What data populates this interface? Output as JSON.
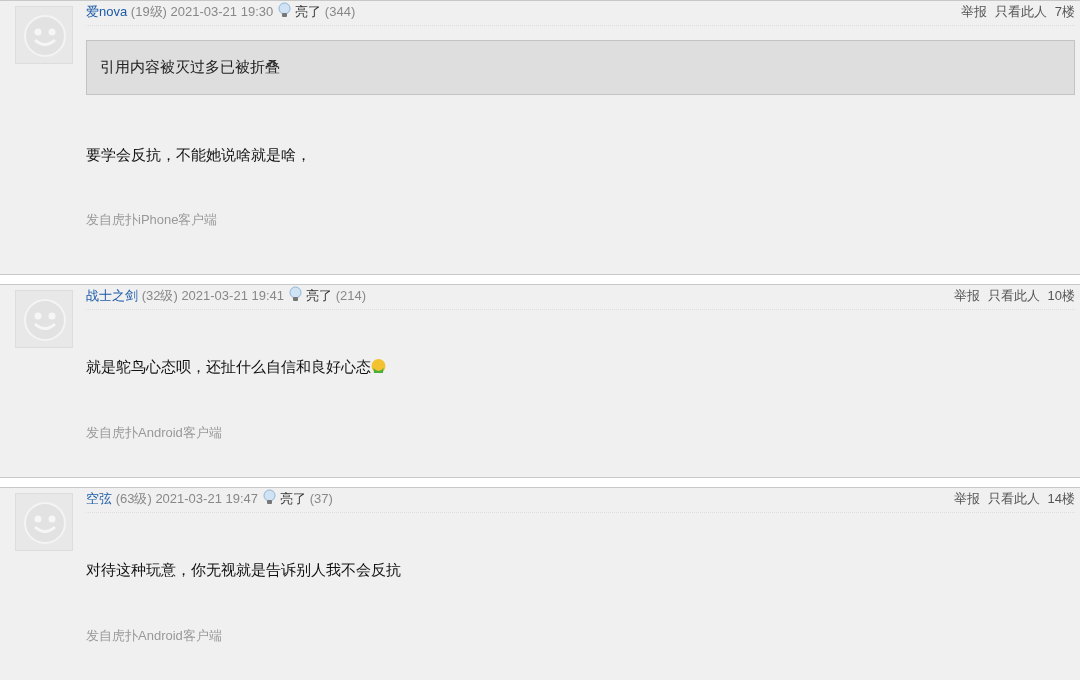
{
  "posts": [
    {
      "user": "爱nova",
      "level": "(19级)",
      "time": "2021-03-21 19:30",
      "light_label": "亮了",
      "light_count": "(344)",
      "actions": [
        "举报",
        "只看此人"
      ],
      "floor": "7楼",
      "quote": "引用内容被灭过多已被折叠",
      "body": "要学会反抗，不能她说啥就是啥，",
      "emoji": false,
      "source": "发自虎扑iPhone客户端"
    },
    {
      "user": "战士之剑",
      "level": "(32级)",
      "time": "2021-03-21 19:41",
      "light_label": "亮了",
      "light_count": "(214)",
      "actions": [
        "举报",
        "只看此人"
      ],
      "floor": "10楼",
      "body": "就是鸵鸟心态呗，还扯什么自信和良好心态",
      "emoji": true,
      "source": "发自虎扑Android客户端"
    },
    {
      "user": "空弦",
      "level": "(63级)",
      "time": "2021-03-21 19:47",
      "light_label": "亮了",
      "light_count": "(37)",
      "actions": [
        "举报",
        "只看此人"
      ],
      "floor": "14楼",
      "body": "对待这种玩意，你无视就是告诉别人我不会反抗",
      "emoji": false,
      "source": "发自虎扑Android客户端"
    }
  ]
}
